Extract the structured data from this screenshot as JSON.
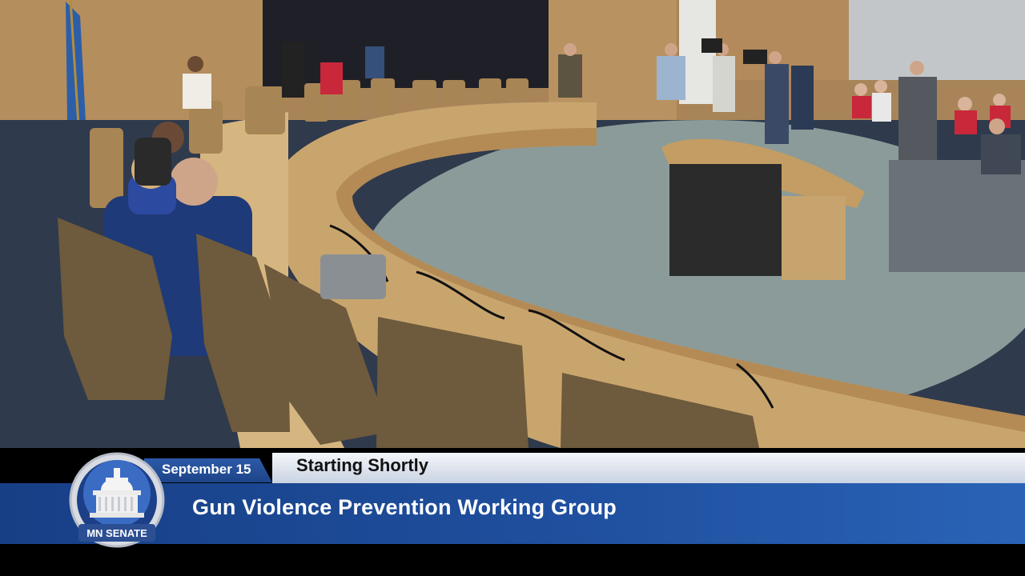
{
  "broadcast": {
    "date": "September 15",
    "status": "Starting Shortly",
    "title": "Gun Violence Prevention Working Group",
    "logo_text": "MN SENATE"
  },
  "colors": {
    "banner_blue": "#1f4f9e",
    "banner_light": "#e6ebf3",
    "wood": "#c9a56e",
    "carpet": "#8a9a98"
  },
  "icons": {
    "seal": "capitol-dome-seal-icon"
  }
}
